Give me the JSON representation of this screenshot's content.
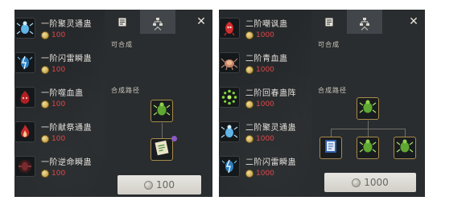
{
  "panel1": {
    "items": [
      {
        "name": "一阶聚灵通蛊",
        "cost": "100",
        "icon": "blue-beetle-icon"
      },
      {
        "name": "一阶闪雷瞬蛊",
        "cost": "100",
        "icon": "lightning-beetle-icon"
      },
      {
        "name": "一阶噬血蛊",
        "cost": "100",
        "icon": "blood-creature-icon"
      },
      {
        "name": "一阶献祭通蛊",
        "cost": "100",
        "icon": "sacrifice-flame-icon"
      },
      {
        "name": "一阶逆命瞬蛊",
        "cost": "100",
        "icon": "dark-beetle-icon"
      }
    ],
    "detail": {
      "label_craftable": "可合成",
      "label_path": "合成路径",
      "cost_button": "100"
    }
  },
  "panel2": {
    "items": [
      {
        "name": "二阶嘲讽蛊",
        "cost": "1000",
        "icon": "red-creature-icon"
      },
      {
        "name": "二阶青血蛊",
        "cost": "1000",
        "icon": "crab-creature-icon"
      },
      {
        "name": "二阶回春蛊阵",
        "cost": "1000",
        "icon": "green-array-icon"
      },
      {
        "name": "二阶聚灵通蛊",
        "cost": "1000",
        "icon": "blue-beetle-icon"
      },
      {
        "name": "二阶闪雷瞬蛊",
        "cost": "1000",
        "icon": "lightning-beetle-icon"
      }
    ],
    "detail": {
      "label_craftable": "可合成",
      "label_path": "合成路径",
      "cost_button": "1000"
    }
  },
  "tabs": {
    "info_icon": "book-icon",
    "tree_icon": "tree-icon",
    "close_label": "✕"
  },
  "colors": {
    "panel_bg": "#26292b",
    "cost_red": "#e0474b",
    "node_border": "#a88a4c"
  }
}
